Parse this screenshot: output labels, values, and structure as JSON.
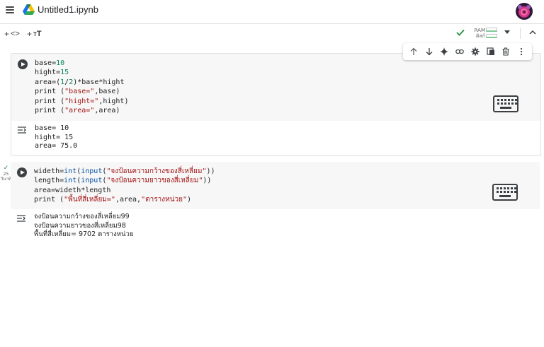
{
  "header": {
    "file_name": "Untitled1.ipynb",
    "icons": [
      "menu-icon",
      "drive-logo-icon",
      "avatar"
    ]
  },
  "toolbar": {
    "add_code_label": "<>",
    "add_text_label": "T",
    "resources": {
      "ram_label": "RAM",
      "disk_label": "ดิสก์"
    }
  },
  "cell_toolbar": {
    "icons": [
      "arrow-up-icon",
      "arrow-down-icon",
      "sparkle-icon",
      "link-icon",
      "gear-icon",
      "mirror-cell-icon",
      "trash-icon",
      "more-vert-icon"
    ]
  },
  "cells": [
    {
      "code_lines": [
        "base=10",
        "hight=15",
        "area=(1/2)*base*hight",
        "print (\"base=\",base)",
        "print (\"hight=\",hight)",
        "print (\"area=\",area)"
      ],
      "output_lines": [
        "base= 10",
        "hight= 15",
        "area= 75.0"
      ]
    },
    {
      "exec_time": "25",
      "exec_unit": "วินาที",
      "code_lines": [
        "wideth=int(input(\"จงป้อนความกว้างของสี่เหลี่ยม\"))",
        "length=int(input(\"จงป้อนความยาวของสี่เหลี่ยม\"))",
        "area=wideth*length",
        "print (\"พื้นที่สี่เหลี่ยม=\",area,\"ตารางหน่วย\")"
      ],
      "output_lines": [
        "จงป้อนความกว้างของสี่เหลี่ยม99",
        "จงป้อนความยาวของสี่เหลี่ยม98",
        "พื้นที่สี่เหลี่ยม= 9702 ตารางหน่วย"
      ]
    }
  ],
  "colors": {
    "accent_green": "#1e8e3e",
    "code_bg": "#f7f7f7",
    "string": "#a31515",
    "number": "#098658"
  }
}
